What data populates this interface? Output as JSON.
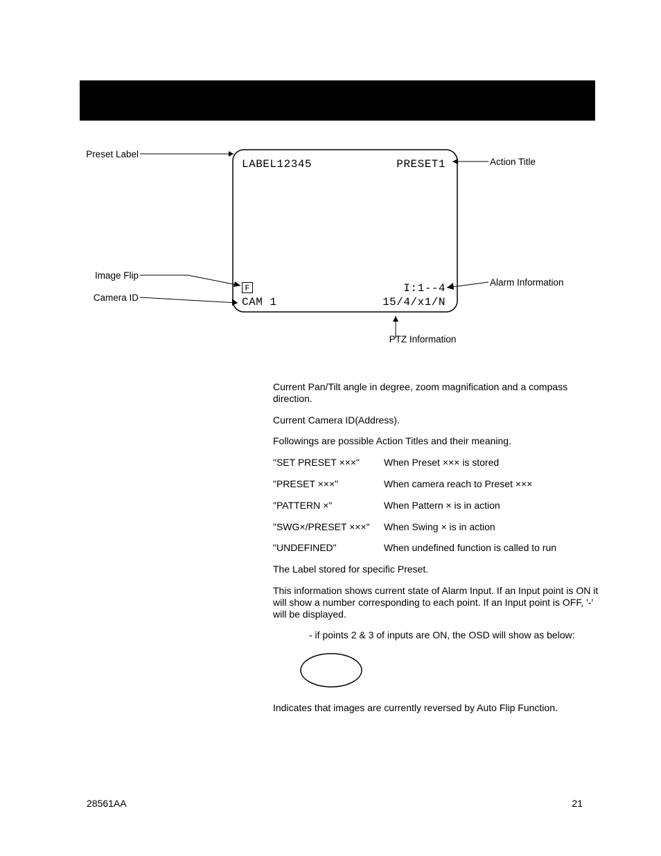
{
  "diagram": {
    "osd": {
      "preset_label": "LABEL12345",
      "action_title": "PRESET1",
      "flip": "F",
      "alarm": "I:1--4",
      "camera_id": "CAM 1",
      "ptz": "15/4/x1/N"
    },
    "callouts": {
      "preset_label": "Preset Label",
      "action_title": "Action Title",
      "image_flip": "Image Flip",
      "camera_id": "Camera ID",
      "alarm_info": "Alarm Information",
      "ptz_info": "PTZ Information"
    }
  },
  "body": {
    "p1": "Current Pan/Tilt angle in degree, zoom magnification and a compass direction.",
    "p2": "Current Camera ID(Address).",
    "p3": "Followings are possible Action Titles and their meaning.",
    "table": [
      {
        "title": "\"SET PRESET ×××\"",
        "desc": "When Preset ××× is stored"
      },
      {
        "title": "\"PRESET ×××\"",
        "desc": "When camera reach to Preset ×××"
      },
      {
        "title": "\"PATTERN ×\"",
        "desc": "When Pattern × is in action"
      },
      {
        "title": "\"SWG×/PRESET ×××\"",
        "desc": "When Swing × is in action"
      },
      {
        "title": "\"UNDEFINED\"",
        "desc": "When undefined function is called to run"
      }
    ],
    "p4": "The Label stored for specific Preset.",
    "p5": "This information shows current state of Alarm Input. If an Input point is ON it will show a number corresponding to each point. If an Input point is OFF, '-' will be displayed.",
    "p6": "- if points 2 & 3 of inputs are ON, the OSD will show as below:",
    "p7": "Indicates that images are currently reversed by Auto Flip Function."
  },
  "footer": {
    "left": "28561AA",
    "right": "21"
  }
}
